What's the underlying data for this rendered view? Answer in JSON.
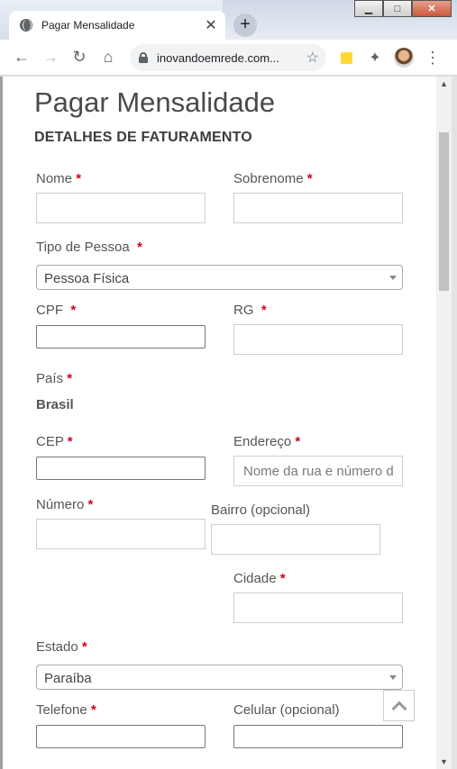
{
  "browser": {
    "tab_title": "Pagar Mensalidade",
    "url": "inovandoemrede.com...",
    "new_tab": "+",
    "tab_close": "✕",
    "back": "←",
    "forward": "→",
    "reload": "↻",
    "home": "⌂",
    "bookmark": "☆",
    "extensions": "✦",
    "menu": "⋮",
    "win_min": "▁",
    "win_max": "□",
    "win_close": "✕"
  },
  "page": {
    "title": "Pagar Mensalidade",
    "section": "DETALHES DE FATURAMENTO",
    "required_mark": "*",
    "fields": {
      "nome": "Nome",
      "sobrenome": "Sobrenome",
      "tipo_pessoa": "Tipo de Pessoa",
      "tipo_pessoa_value": "Pessoa Física",
      "cpf": "CPF",
      "rg": "RG",
      "pais": "País",
      "pais_value": "Brasil",
      "cep": "CEP",
      "endereco": "Endereço",
      "endereco_placeholder": "Nome da rua e número d",
      "numero": "Número",
      "bairro": "Bairro (opcional)",
      "cidade": "Cidade",
      "estado": "Estado",
      "estado_value": "Paraíba",
      "telefone": "Telefone",
      "celular": "Celular (opcional)"
    }
  },
  "icons": [
    "globe-icon",
    "lock-icon",
    "star-icon",
    "sticky-note-icon",
    "puzzle-icon",
    "avatar",
    "menu-icon",
    "scroll-top-icon"
  ]
}
